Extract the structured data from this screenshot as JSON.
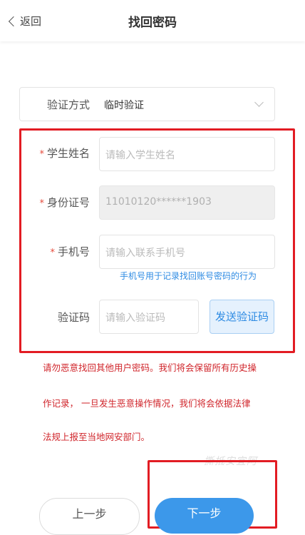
{
  "header": {
    "back_label": "返回",
    "title": "找回密码"
  },
  "form": {
    "verify_method": {
      "label": "验证方式",
      "value": "临时验证"
    },
    "student_name": {
      "label": "学生姓名",
      "placeholder": "请输入学生姓名",
      "required": true
    },
    "id_number": {
      "label": "身份证号",
      "value": "11010120******1903",
      "required": true
    },
    "phone": {
      "label": "手机号",
      "placeholder": "请输入联系手机号",
      "required": true,
      "hint": "手机号用于记录找回账号密码的行为"
    },
    "code": {
      "label": "验证码",
      "placeholder": "请输入验证码",
      "send_button": "发送验证码"
    },
    "required_mark": "*"
  },
  "warning": {
    "line1": "请勿恶意找回其他用户密码。我们将会保留所有历史操",
    "line2": "作记录， 一旦发生恶意操作情况，我们将会依据法律",
    "line3": "法规上报至当地网安部门。"
  },
  "watermark": "撕抵安宜阿",
  "footer": {
    "prev_label": "上一步",
    "next_label": "下一步"
  },
  "colors": {
    "accent": "#2e8be3",
    "warning": "#d0252b",
    "highlight_frame": "#e21c23",
    "next_button": "#3c98ea"
  }
}
